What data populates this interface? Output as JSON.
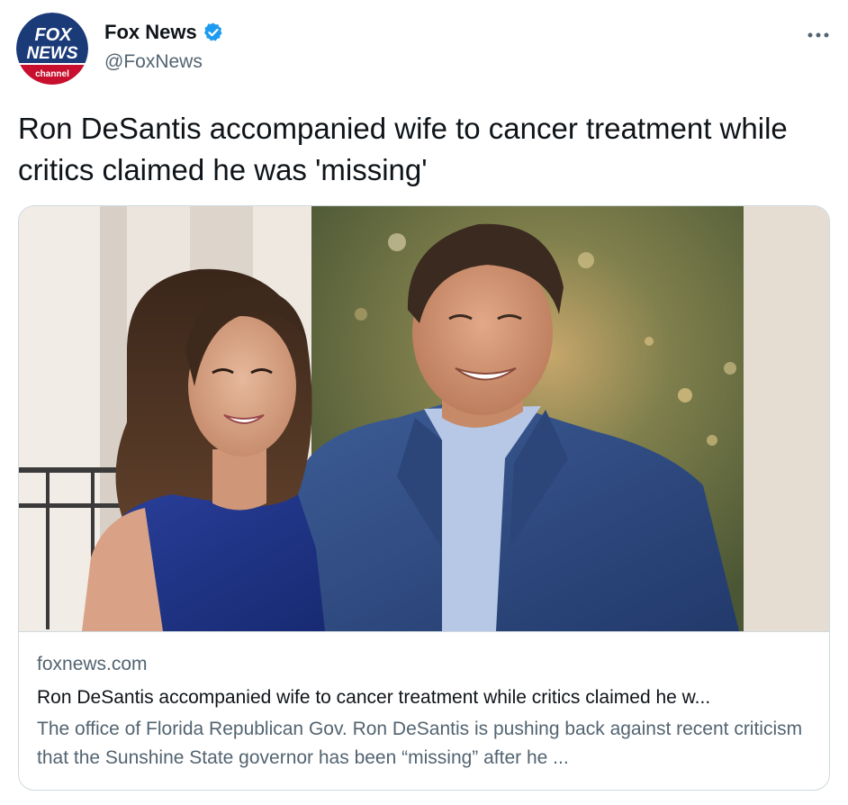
{
  "author": {
    "name": "Fox News",
    "handle": "@FoxNews",
    "verified": true,
    "avatar": {
      "logo_line1": "FOX",
      "logo_line2": "NEWS",
      "logo_line3": "channel"
    }
  },
  "icons": {
    "verified": "verified-badge-icon",
    "more": "more-options-icon"
  },
  "tweet": {
    "text": "Ron DeSantis accompanied wife to cancer treatment while critics claimed he was 'missing'"
  },
  "card": {
    "domain": "foxnews.com",
    "title": "Ron DeSantis accompanied wife to cancer treatment while critics claimed he w...",
    "description": "The office of Florida Republican Gov. Ron DeSantis is pushing back against recent criticism that the Sunshine State governor has been “missing” after he ..."
  },
  "colors": {
    "verified": "#1d9bf0",
    "text_primary": "#0f1419",
    "text_secondary": "#536471",
    "border": "#cfd9de",
    "fox_blue": "#1b3a78",
    "fox_red": "#c8102e"
  }
}
